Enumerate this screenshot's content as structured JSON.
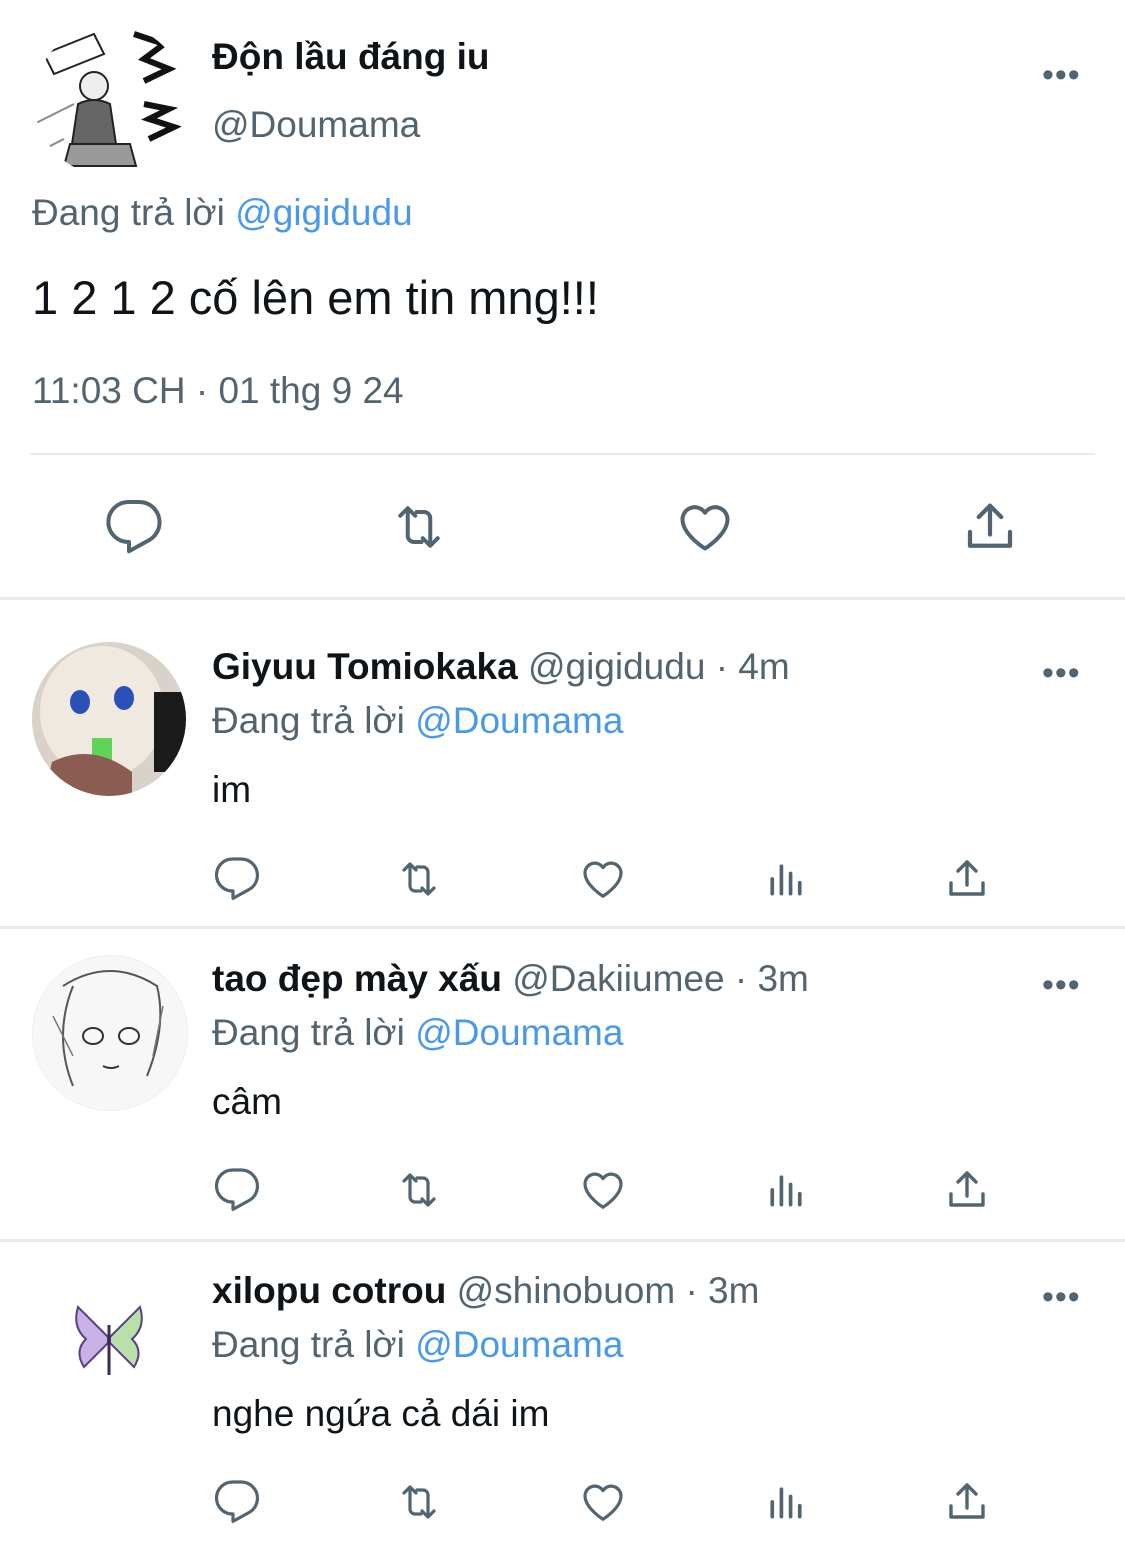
{
  "colors": {
    "accent": "#4a99e9",
    "muted": "#536471",
    "text": "#0f1419",
    "divider": "#e6ecf0"
  },
  "main_tweet": {
    "display_name": "Độn lầu đáng iu",
    "handle": "@Doumama",
    "replying_prefix": "Đang trả lời",
    "replying_to": "@gigidudu",
    "text": "1 2 1 2 cố lên em tin mng!!!",
    "timestamp": "11:03 CH · 01 thg 9 24",
    "more": "•••",
    "actions": [
      "reply-icon",
      "retweet-icon",
      "heart-icon",
      "share-icon"
    ]
  },
  "replies": [
    {
      "display_name": "Giyuu Tomiokaka",
      "handle_meta": "@gigidudu · 4m",
      "replying_prefix": "Đang trả lời",
      "replying_to": "@Doumama",
      "text": "im",
      "more": "•••"
    },
    {
      "display_name": "tao đẹp mày xấu",
      "handle_meta": "@Dakiiumee · 3m",
      "replying_prefix": "Đang trả lời",
      "replying_to": "@Doumama",
      "text": "câm",
      "more": "•••"
    },
    {
      "display_name": "xilopu cotrou",
      "handle_meta": "@shinobuom · 3m",
      "replying_prefix": "Đang trả lời",
      "replying_to": "@Doumama",
      "text": "nghe ngứa cả dái im",
      "more": "•••"
    }
  ],
  "reply_actions": [
    "reply-icon",
    "retweet-icon",
    "heart-icon",
    "analytics-icon",
    "share-icon"
  ]
}
